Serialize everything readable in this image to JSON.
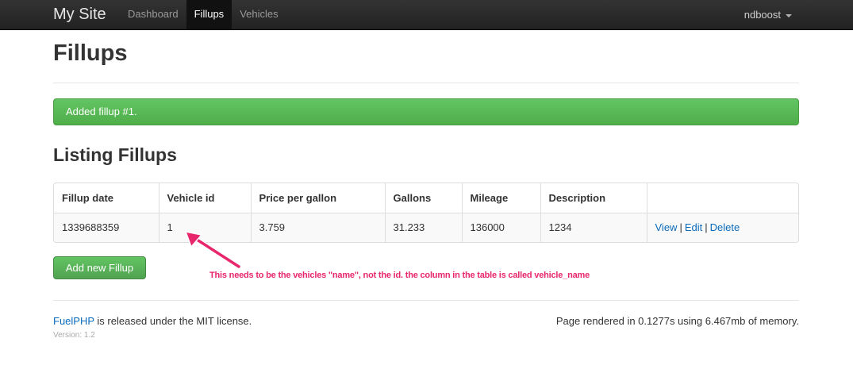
{
  "navbar": {
    "brand": "My Site",
    "items": [
      {
        "label": "Dashboard"
      },
      {
        "label": "Fillups"
      },
      {
        "label": "Vehicles"
      }
    ],
    "user": "ndboost"
  },
  "page": {
    "title": "Fillups",
    "alert": "Added fillup #1.",
    "section_title": "Listing Fillups"
  },
  "table": {
    "headers": [
      "Fillup date",
      "Vehicle id",
      "Price per gallon",
      "Gallons",
      "Mileage",
      "Description",
      ""
    ],
    "rows": [
      {
        "fillup_date": "1339688359",
        "vehicle_id": "1",
        "price_per_gallon": "3.759",
        "gallons": "31.233",
        "mileage": "136000",
        "description": "1234",
        "actions": {
          "view": "View",
          "edit": "Edit",
          "delete": "Delete",
          "separator": "|"
        }
      }
    ]
  },
  "add_button": "Add new Fillup",
  "annotation": "This needs to be the vehicles \"name\", not the id.  the column in the table is called vehicle_name",
  "footer": {
    "link": "FuelPHP",
    "left_text": " is released under the MIT license.",
    "right_text": "Page rendered in 0.1277s using 6.467mb of memory.",
    "version": "Version: 1.2"
  },
  "colors": {
    "annotation": "#e8266c",
    "alert_bg": "#5bb75b",
    "link": "#0a6bbb"
  }
}
